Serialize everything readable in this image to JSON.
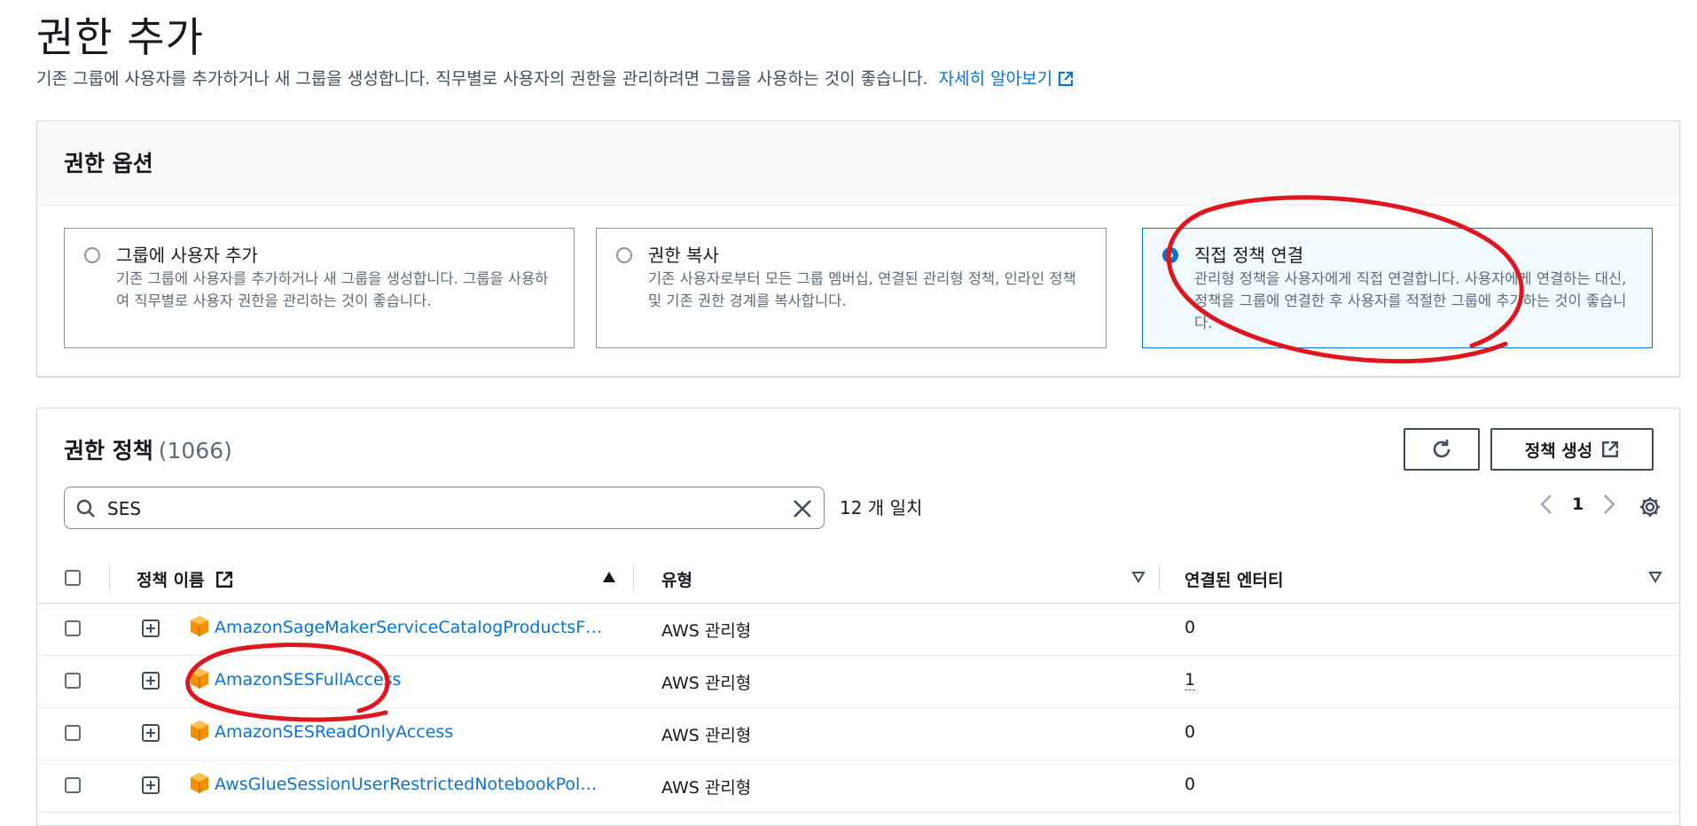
{
  "header": {
    "title": "권한 추가",
    "subtitle": "기존 그룹에 사용자를 추가하거나 새 그룹을 생성합니다. 직무별로 사용자의 권한을 관리하려면 그룹을 사용하는 것이 좋습니다.",
    "learn_more": "자세히 알아보기"
  },
  "options": {
    "heading": "권한 옵션",
    "tiles": [
      {
        "label": "그룹에 사용자 추가",
        "desc": "기존 그룹에 사용자를 추가하거나 새 그룹을 생성합니다. 그룹을 사용하여 직무별로 사용자 권한을 관리하는 것이 좋습니다.",
        "selected": false
      },
      {
        "label": "권한 복사",
        "desc": "기존 사용자로부터 모든 그룹 멤버십, 연결된 관리형 정책, 인라인 정책 및 기존 권한 경계를 복사합니다.",
        "selected": false
      },
      {
        "label": "직접 정책 연결",
        "desc": "관리형 정책을 사용자에게 직접 연결합니다. 사용자에게 연결하는 대신, 정책을 그룹에 연결한 후 사용자를 적절한 그룹에 추가하는 것이 좋습니다.",
        "selected": true
      }
    ]
  },
  "policies": {
    "heading": "권한 정책",
    "count": "(1066)",
    "create_button": "정책 생성",
    "search": {
      "value": "SES",
      "placeholder": ""
    },
    "match_count": "12 개 일치",
    "page": "1",
    "columns": {
      "name": "정책 이름",
      "type": "유형",
      "entities": "연결된 엔터티"
    },
    "rows": [
      {
        "name": "AmazonSageMakerServiceCatalogProductsF…",
        "type": "AWS 관리형",
        "entities": "0"
      },
      {
        "name": "AmazonSESFullAccess",
        "type": "AWS 관리형",
        "entities": "1"
      },
      {
        "name": "AmazonSESReadOnlyAccess",
        "type": "AWS 관리형",
        "entities": "0"
      },
      {
        "name": "AwsGlueSessionUserRestrictedNotebookPol…",
        "type": "AWS 관리형",
        "entities": "0"
      }
    ]
  },
  "colors": {
    "accent": "#0972d3",
    "annotation": "#e0161e"
  }
}
